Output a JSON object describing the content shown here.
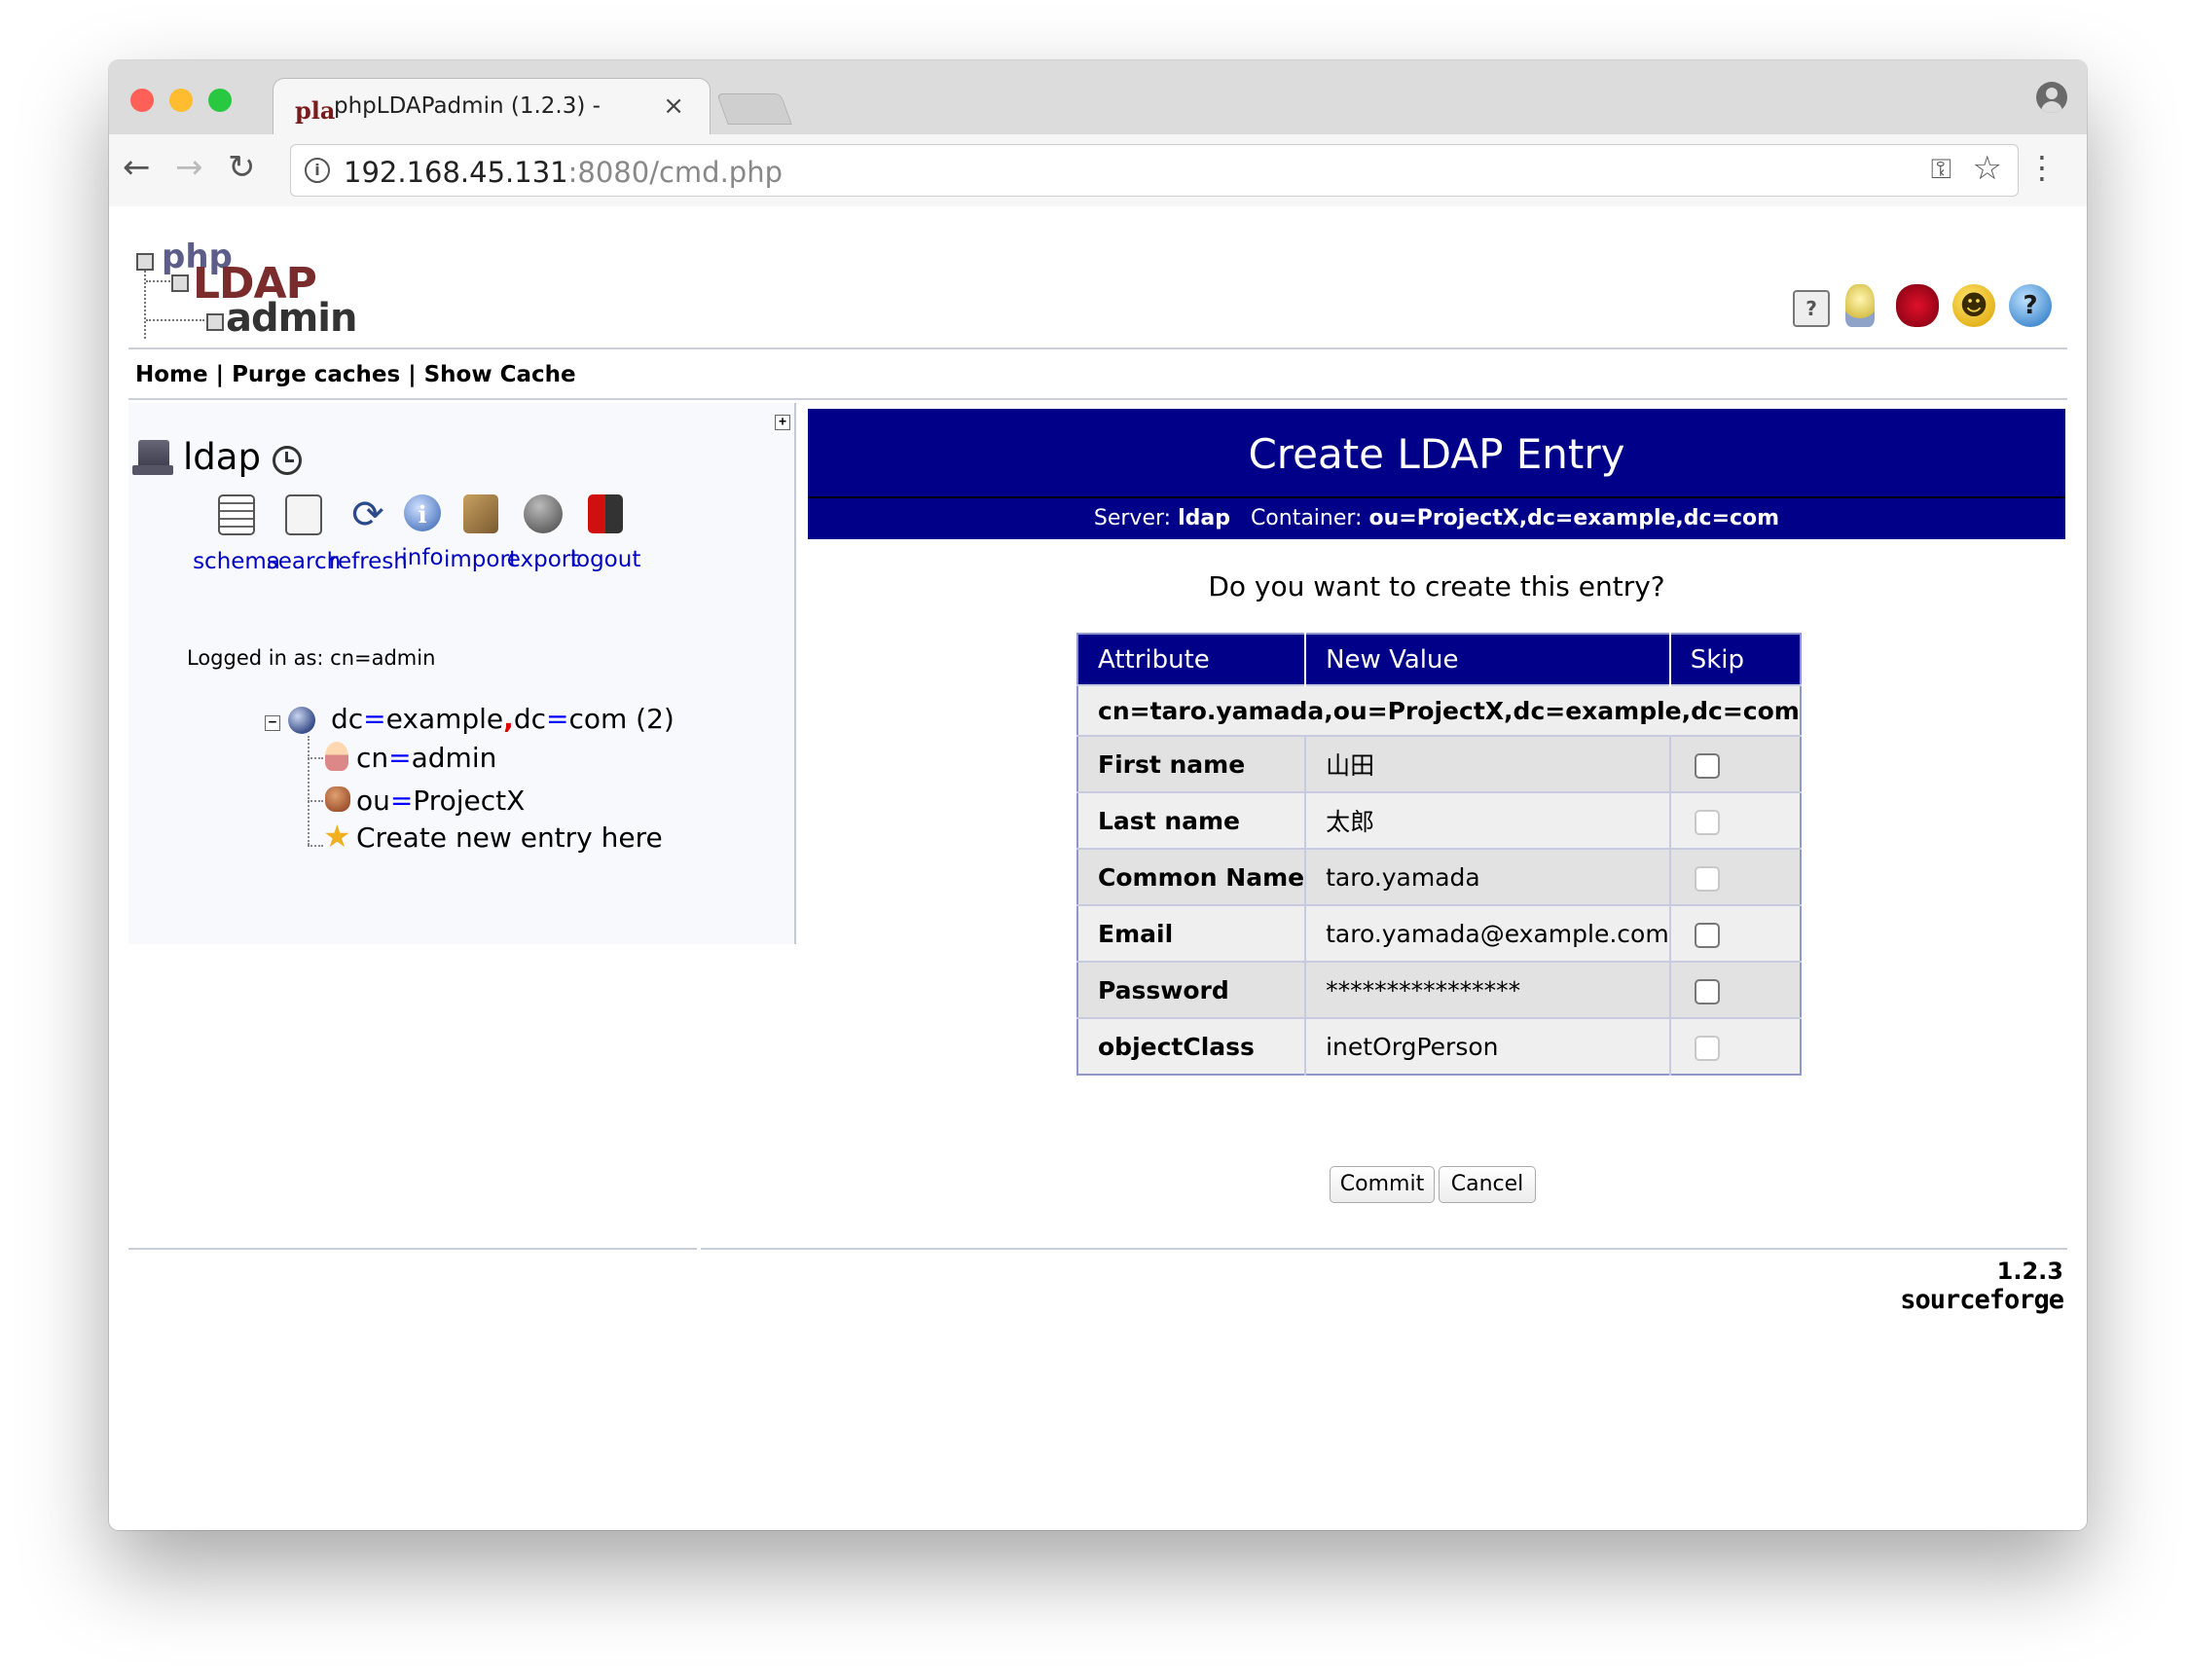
{
  "browser": {
    "tab_title": "phpLDAPadmin (1.2.3) -",
    "tab_favicon": "pla",
    "tab_close": "×",
    "url_host": "192.168.45.131",
    "url_rest": ":8080/cmd.php",
    "icons": [
      "back-arrow-icon",
      "forward-arrow-icon",
      "reload-icon",
      "info-icon",
      "key-icon",
      "star-icon",
      "menu-dots-icon",
      "profile-icon"
    ]
  },
  "app": {
    "logo": {
      "php": "php",
      "ldap": "LDAP",
      "admin": "admin"
    },
    "header_icons": [
      "help-icon",
      "idea-icon",
      "bug-icon",
      "smiley-icon",
      "question-icon"
    ],
    "nav": {
      "home": "Home",
      "sep": "|",
      "purge": "Purge caches",
      "show_cache": "Show Cache"
    }
  },
  "sidebar": {
    "server_name": "ldap",
    "actions": [
      {
        "label": "schema"
      },
      {
        "label": "search"
      },
      {
        "label": "refresh"
      },
      {
        "label": "info"
      },
      {
        "label": "import"
      },
      {
        "label": "export"
      },
      {
        "label": "logout"
      }
    ],
    "logged_in_label": "Logged in as:",
    "logged_in_user": "cn=admin",
    "tree": {
      "root": {
        "dc1": "dc",
        "v1": "example",
        "dc2": "dc",
        "v2": "com",
        "count": "(2)"
      },
      "children": [
        {
          "attr": "cn",
          "value": "admin"
        },
        {
          "attr": "ou",
          "value": "ProjectX"
        }
      ],
      "create_label": "Create new entry here"
    }
  },
  "main": {
    "title": "Create LDAP Entry",
    "server_label": "Server:",
    "server_value": "ldap",
    "container_label": "Container:",
    "container_value": "ou=ProjectX,dc=example,dc=com",
    "question": "Do you want to create this entry?",
    "table": {
      "headers": [
        "Attribute",
        "New Value",
        "Skip"
      ],
      "dn": "cn=taro.yamada,ou=ProjectX,dc=example,dc=com",
      "rows": [
        {
          "attr": "First name",
          "value": "山田",
          "skip_enabled": true
        },
        {
          "attr": "Last name",
          "value": "太郎",
          "skip_enabled": false
        },
        {
          "attr": "Common Name",
          "value": "taro.yamada",
          "skip_enabled": false
        },
        {
          "attr": "Email",
          "value": "taro.yamada@example.com",
          "skip_enabled": true
        },
        {
          "attr": "Password",
          "value": "****************",
          "skip_enabled": true
        },
        {
          "attr": "objectClass",
          "value": "inetOrgPerson",
          "skip_enabled": false
        }
      ]
    },
    "commit_label": "Commit",
    "cancel_label": "Cancel"
  },
  "footer": {
    "version": "1.2.3",
    "sourceforge": "sourceforge"
  },
  "colors": {
    "banner": "#000088",
    "link": "#0000c0",
    "close_red": "#fe5f57",
    "min_yellow": "#febc2e",
    "max_green": "#28c840"
  }
}
